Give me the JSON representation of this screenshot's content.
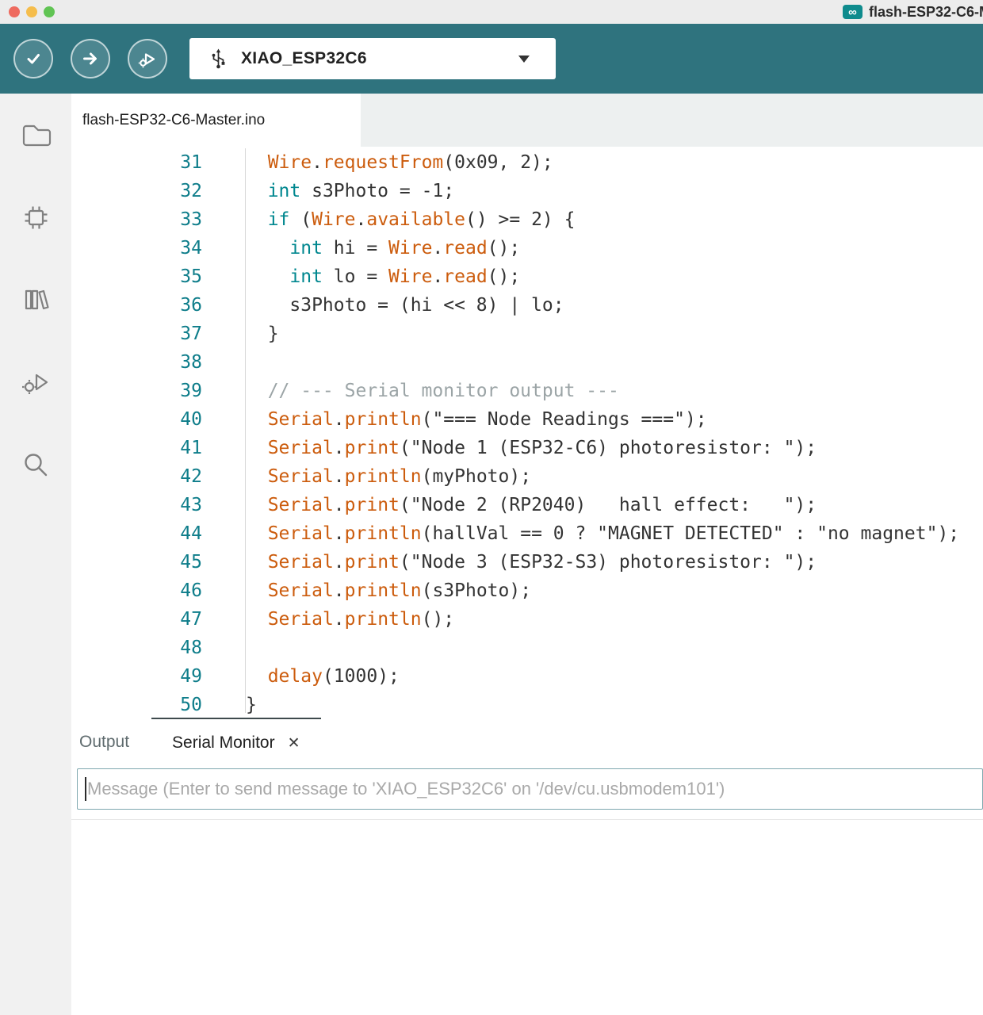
{
  "titlebar": {
    "title": "flash-ESP32-C6-M"
  },
  "toolbar": {
    "board_selector": "XIAO_ESP32C6",
    "verify_tooltip": "Verify",
    "upload_tooltip": "Upload",
    "debug_tooltip": "Start Debugging"
  },
  "sidebar": {
    "icons": [
      "folder-icon",
      "boards-chip-icon",
      "library-books-icon",
      "debug-play-gear-icon",
      "search-icon"
    ]
  },
  "tab": {
    "filename": "flash-ESP32-C6-Master.ino"
  },
  "panel": {
    "output_label": "Output",
    "serial_label": "Serial Monitor",
    "close_glyph": "✕",
    "input_placeholder": "Message (Enter to send message to 'XIAO_ESP32C6' on '/dev/cu.usbmodem101')"
  },
  "colors": {
    "toolbar_bg": "#2F737E",
    "titlebar_bg": "#ECECEC",
    "sidebar_bg": "#F1F1F1",
    "tabbar_bg": "#EDF0F0",
    "accent_badge": "#0F8B8D",
    "tok_pl": "#333333",
    "tok_kw": "#00878F",
    "tok_fn": "#CC5C0D",
    "tok_cm": "#9BA4A6",
    "tok_str": "#333333",
    "line_number": "#0E7D8A",
    "selected_panel_tab_border": "#3E4A4D",
    "input_border": "#7FA8AF",
    "placeholder": "#A9A9A9"
  },
  "code": {
    "lines": [
      {
        "num": 31,
        "tokens": [
          {
            "t": "pl",
            "s": "  "
          },
          {
            "t": "fn",
            "s": "Wire"
          },
          {
            "t": "pl",
            "s": "."
          },
          {
            "t": "fn",
            "s": "requestFrom"
          },
          {
            "t": "pl",
            "s": "(0x09, 2);"
          }
        ]
      },
      {
        "num": 32,
        "tokens": [
          {
            "t": "pl",
            "s": "  "
          },
          {
            "t": "kw",
            "s": "int"
          },
          {
            "t": "pl",
            "s": " s3Photo = -1;"
          }
        ]
      },
      {
        "num": 33,
        "tokens": [
          {
            "t": "pl",
            "s": "  "
          },
          {
            "t": "kw",
            "s": "if"
          },
          {
            "t": "pl",
            "s": " ("
          },
          {
            "t": "fn",
            "s": "Wire"
          },
          {
            "t": "pl",
            "s": "."
          },
          {
            "t": "fn",
            "s": "available"
          },
          {
            "t": "pl",
            "s": "() >= 2) {"
          }
        ]
      },
      {
        "num": 34,
        "tokens": [
          {
            "t": "pl",
            "s": "    "
          },
          {
            "t": "kw",
            "s": "int"
          },
          {
            "t": "pl",
            "s": " hi = "
          },
          {
            "t": "fn",
            "s": "Wire"
          },
          {
            "t": "pl",
            "s": "."
          },
          {
            "t": "fn",
            "s": "read"
          },
          {
            "t": "pl",
            "s": "();"
          }
        ]
      },
      {
        "num": 35,
        "tokens": [
          {
            "t": "pl",
            "s": "    "
          },
          {
            "t": "kw",
            "s": "int"
          },
          {
            "t": "pl",
            "s": " lo = "
          },
          {
            "t": "fn",
            "s": "Wire"
          },
          {
            "t": "pl",
            "s": "."
          },
          {
            "t": "fn",
            "s": "read"
          },
          {
            "t": "pl",
            "s": "();"
          }
        ]
      },
      {
        "num": 36,
        "tokens": [
          {
            "t": "pl",
            "s": "    s3Photo = (hi << 8) | lo;"
          }
        ]
      },
      {
        "num": 37,
        "tokens": [
          {
            "t": "pl",
            "s": "  }"
          }
        ]
      },
      {
        "num": 38,
        "tokens": []
      },
      {
        "num": 39,
        "tokens": [
          {
            "t": "cm",
            "s": "  // --- Serial monitor output ---"
          }
        ]
      },
      {
        "num": 40,
        "tokens": [
          {
            "t": "pl",
            "s": "  "
          },
          {
            "t": "fn",
            "s": "Serial"
          },
          {
            "t": "pl",
            "s": "."
          },
          {
            "t": "fn",
            "s": "println"
          },
          {
            "t": "pl",
            "s": "("
          },
          {
            "t": "str",
            "s": "\"=== Node Readings ===\""
          },
          {
            "t": "pl",
            "s": ");"
          }
        ]
      },
      {
        "num": 41,
        "tokens": [
          {
            "t": "pl",
            "s": "  "
          },
          {
            "t": "fn",
            "s": "Serial"
          },
          {
            "t": "pl",
            "s": "."
          },
          {
            "t": "fn",
            "s": "print"
          },
          {
            "t": "pl",
            "s": "("
          },
          {
            "t": "str",
            "s": "\"Node 1 (ESP32-C6) photoresistor: \""
          },
          {
            "t": "pl",
            "s": ");"
          }
        ]
      },
      {
        "num": 42,
        "tokens": [
          {
            "t": "pl",
            "s": "  "
          },
          {
            "t": "fn",
            "s": "Serial"
          },
          {
            "t": "pl",
            "s": "."
          },
          {
            "t": "fn",
            "s": "println"
          },
          {
            "t": "pl",
            "s": "(myPhoto);"
          }
        ]
      },
      {
        "num": 43,
        "tokens": [
          {
            "t": "pl",
            "s": "  "
          },
          {
            "t": "fn",
            "s": "Serial"
          },
          {
            "t": "pl",
            "s": "."
          },
          {
            "t": "fn",
            "s": "print"
          },
          {
            "t": "pl",
            "s": "("
          },
          {
            "t": "str",
            "s": "\"Node 2 (RP2040)   hall effect:   \""
          },
          {
            "t": "pl",
            "s": ");"
          }
        ]
      },
      {
        "num": 44,
        "tokens": [
          {
            "t": "pl",
            "s": "  "
          },
          {
            "t": "fn",
            "s": "Serial"
          },
          {
            "t": "pl",
            "s": "."
          },
          {
            "t": "fn",
            "s": "println"
          },
          {
            "t": "pl",
            "s": "(hallVal == 0 ? "
          },
          {
            "t": "str",
            "s": "\"MAGNET DETECTED\""
          },
          {
            "t": "pl",
            "s": " : "
          },
          {
            "t": "str",
            "s": "\"no magnet\""
          },
          {
            "t": "pl",
            "s": ");"
          }
        ]
      },
      {
        "num": 45,
        "tokens": [
          {
            "t": "pl",
            "s": "  "
          },
          {
            "t": "fn",
            "s": "Serial"
          },
          {
            "t": "pl",
            "s": "."
          },
          {
            "t": "fn",
            "s": "print"
          },
          {
            "t": "pl",
            "s": "("
          },
          {
            "t": "str",
            "s": "\"Node 3 (ESP32-S3) photoresistor: \""
          },
          {
            "t": "pl",
            "s": ");"
          }
        ]
      },
      {
        "num": 46,
        "tokens": [
          {
            "t": "pl",
            "s": "  "
          },
          {
            "t": "fn",
            "s": "Serial"
          },
          {
            "t": "pl",
            "s": "."
          },
          {
            "t": "fn",
            "s": "println"
          },
          {
            "t": "pl",
            "s": "(s3Photo);"
          }
        ]
      },
      {
        "num": 47,
        "tokens": [
          {
            "t": "pl",
            "s": "  "
          },
          {
            "t": "fn",
            "s": "Serial"
          },
          {
            "t": "pl",
            "s": "."
          },
          {
            "t": "fn",
            "s": "println"
          },
          {
            "t": "pl",
            "s": "();"
          }
        ]
      },
      {
        "num": 48,
        "tokens": []
      },
      {
        "num": 49,
        "tokens": [
          {
            "t": "pl",
            "s": "  "
          },
          {
            "t": "fn",
            "s": "delay"
          },
          {
            "t": "pl",
            "s": "(1000);"
          }
        ]
      },
      {
        "num": 50,
        "tokens": [
          {
            "t": "pl",
            "s": "}"
          }
        ]
      }
    ]
  }
}
